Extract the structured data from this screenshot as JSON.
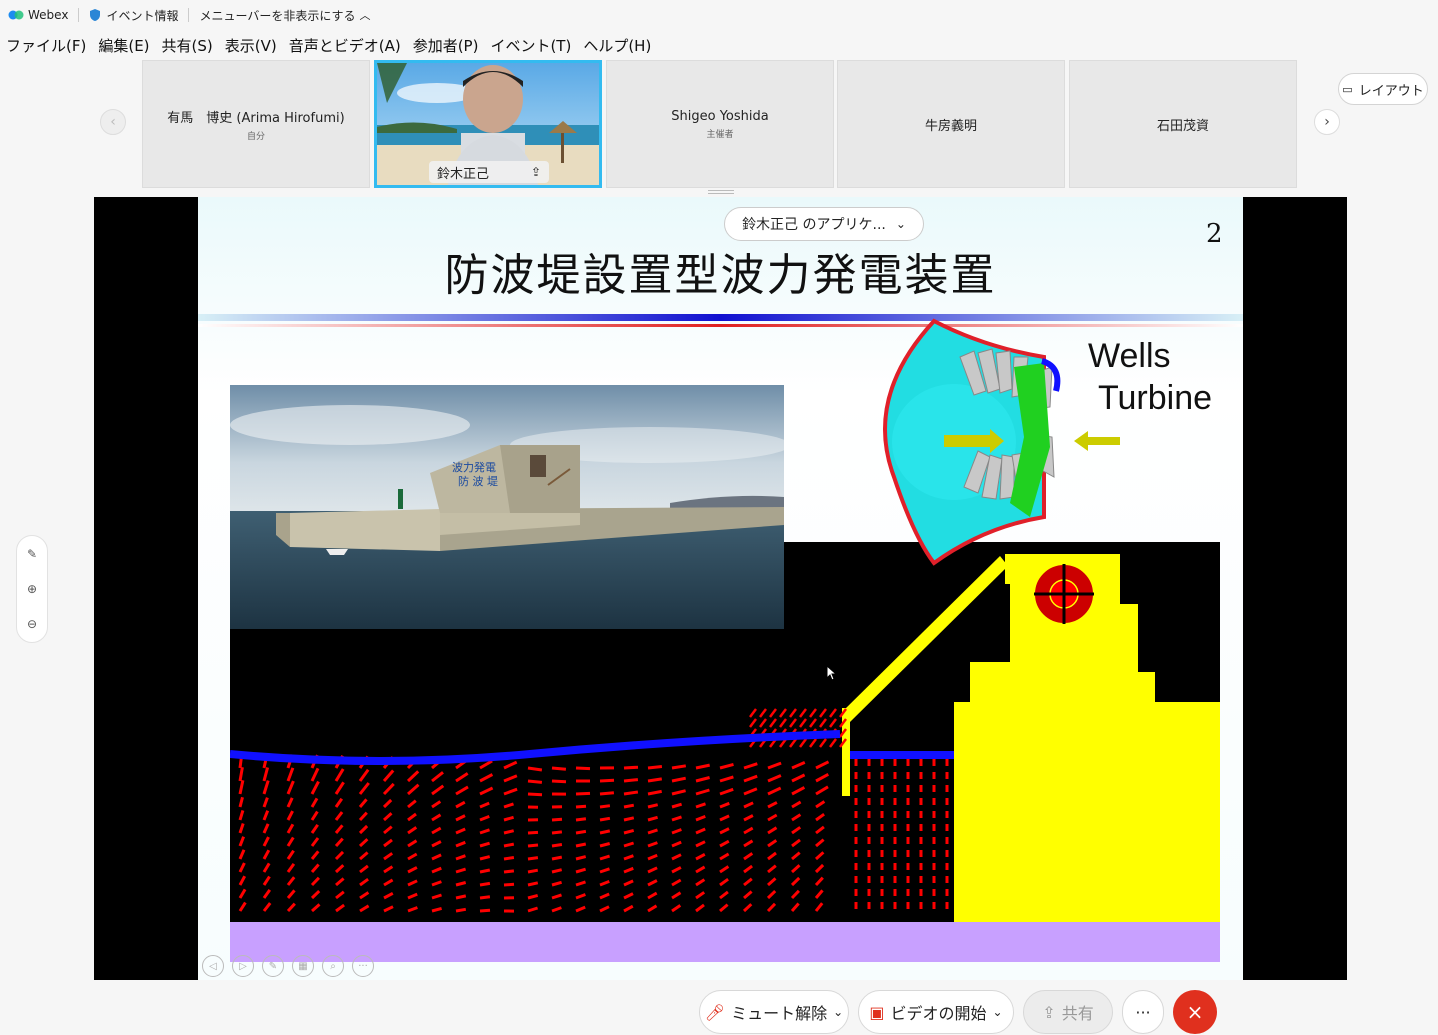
{
  "titlebar": {
    "app_name": "Webex",
    "event_info": "イベント情報",
    "hide_menu": "メニューバーを非表示にする"
  },
  "menu": [
    "ファイル(F)",
    "編集(E)",
    "共有(S)",
    "表示(V)",
    "音声とビデオ(A)",
    "参加者(P)",
    "イベント(T)",
    "ヘルプ(H)"
  ],
  "participants": [
    {
      "name": "有馬　博史 (Arima Hirofumi)",
      "role": "自分"
    },
    {
      "name": "鈴木正己",
      "role": ""
    },
    {
      "name": "Shigeo Yoshida",
      "role": "主催者"
    },
    {
      "name": "牛房義明",
      "role": ""
    },
    {
      "name": "石田茂資",
      "role": ""
    }
  ],
  "layout_label": "レイアウト",
  "share": {
    "pill_label": "鈴木正己 のアプリケ...",
    "slide_title": "防波堤設置型波力発電装置",
    "slide_number": "2",
    "wells_line1": "Wells",
    "wells_line2": "Turbine",
    "photo_sign": "波力発電\n防波堤"
  },
  "bottom": {
    "unmute": "ミュート解除",
    "start_video": "ビデオの開始",
    "share": "共有",
    "more": "···",
    "end": "×"
  },
  "colors": {
    "accent": "#33bbf0",
    "end_red": "#e0301e",
    "wave_blue": "#1010ff",
    "arrow_red": "#ff0000",
    "structure_yellow": "#ffff00",
    "seabed_purple": "#c8a0ff"
  }
}
